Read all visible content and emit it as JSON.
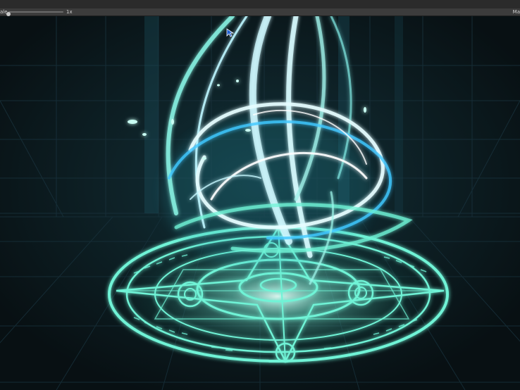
{
  "toolbar": {},
  "scene_toolbar": {
    "scale_label": "ale",
    "scale_value_label": "1x",
    "scale_value": 1,
    "maximize_label": "Ma"
  },
  "viewport": {
    "description_colors": {
      "background": "#0b1518",
      "glow_primary": "#6ff3d6",
      "glow_secondary": "#bdf6ff",
      "glow_blue": "#40c8ff"
    },
    "cursor": "arrow-cursor"
  }
}
